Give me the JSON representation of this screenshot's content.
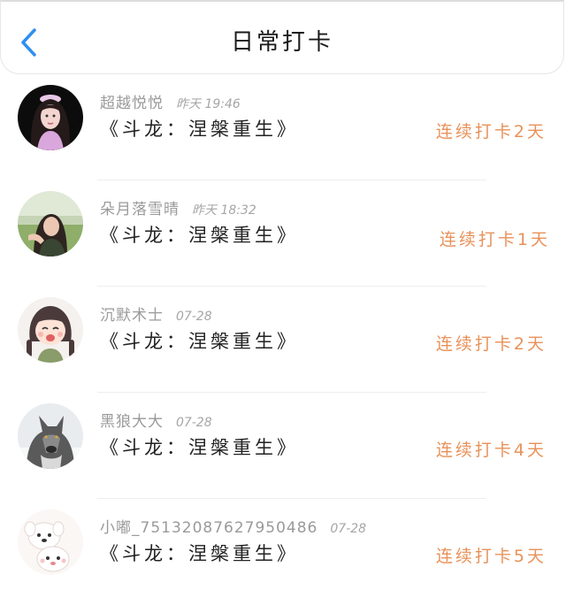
{
  "header": {
    "title": "日常打卡"
  },
  "colors": {
    "accent": "#2f8ff0",
    "streak": "#e8925a",
    "meta": "#9a9a9a"
  },
  "items": [
    {
      "name": "超越悦悦",
      "time": "昨天 19:46",
      "book": "《斗龙：涅槃重生》",
      "streak": "连续打卡2天",
      "avatar_icon": "girl-portrait"
    },
    {
      "name": "朵月落雪晴",
      "time": "昨天 18:32",
      "book": "《斗龙：涅槃重生》",
      "streak": "连续打卡1天",
      "avatar_icon": "woman-outdoor-photo"
    },
    {
      "name": "沉默术士",
      "time": "07-28",
      "book": "《斗龙：涅槃重生》",
      "streak": "连续打卡2天",
      "avatar_icon": "cartoon-girl-braids"
    },
    {
      "name": "黑狼大大",
      "time": "07-28",
      "book": "《斗龙：涅槃重生》",
      "streak": "连续打卡4天",
      "avatar_icon": "wolf-photo"
    },
    {
      "name": "小嘟_7513208762795048​6",
      "time": "07-28",
      "book": "《斗龙：涅槃重生》",
      "streak": "连续打卡5天",
      "avatar_icon": "cartoon-white-puppies"
    }
  ]
}
